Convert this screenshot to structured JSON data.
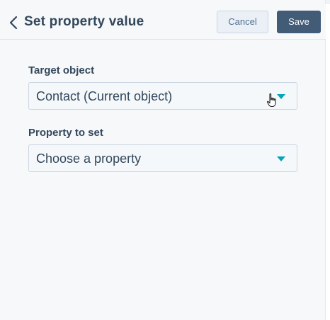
{
  "header": {
    "title": "Set property value",
    "back_icon": "chevron-left-icon",
    "cancel_label": "Cancel",
    "save_label": "Save"
  },
  "form": {
    "target_object": {
      "label": "Target object",
      "value": "Contact (Current object)"
    },
    "property_to_set": {
      "label": "Property to set",
      "value": "Choose a property"
    }
  },
  "colors": {
    "accent_caret": "#00a4bd",
    "save_button": "#425b76",
    "panel_background": "#f6f8fa",
    "text": "#33475b"
  },
  "icons": {
    "dropdown": "caret-down-icon",
    "pointer": "hand-pointer-icon"
  }
}
